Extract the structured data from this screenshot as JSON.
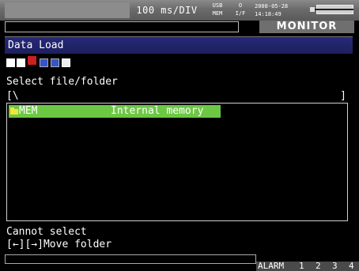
{
  "status_bar": {
    "time_div": "100 ms/DIV",
    "usb_line1": "USB",
    "usb_line2": "MEM",
    "io_line1": "O",
    "io_line2": "I/F",
    "date": "2008-05-28",
    "time": "14:18:49",
    "mode": "MONITOR"
  },
  "dialog": {
    "title": "Data Load",
    "icons": [
      "rewind-icon",
      "search-icon",
      "download-icon",
      "blue-box-icon",
      "blue-box2-icon",
      "forward-icon"
    ],
    "prompt": "Select file/folder",
    "path_open": "[\\",
    "path_close": "]",
    "items": [
      {
        "name": "MEM",
        "description": "Internal memory"
      }
    ],
    "status": "Cannot select",
    "hint": "[←][→]Move folder"
  },
  "bottom_bar": {
    "alarm_label": "ALARM",
    "channels": [
      "1",
      "2",
      "3",
      "4"
    ]
  }
}
